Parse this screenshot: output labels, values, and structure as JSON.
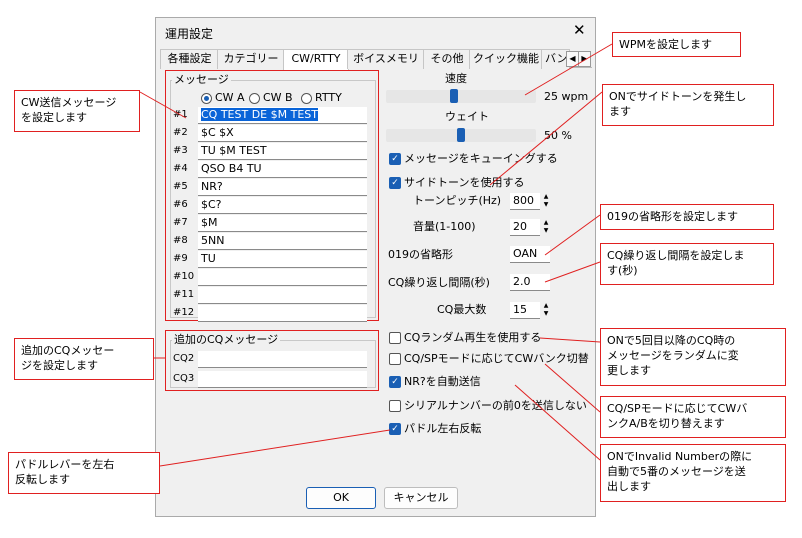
{
  "dialog": {
    "title": "運用設定",
    "close_glyph": "✕"
  },
  "tabs": [
    "各種設定",
    "カテゴリー",
    "CW/RTTY",
    "ボイスメモリ",
    "その他",
    "クイック機能",
    "バン"
  ],
  "tab_nav": {
    "prev": "◀",
    "next": "▶"
  },
  "messages": {
    "legend": "メッセージ",
    "modes": [
      "CW A",
      "CW B",
      "RTTY"
    ],
    "selected_mode": "CW A",
    "rows": [
      {
        "num": "#1",
        "text": "CQ TEST DE $M TEST"
      },
      {
        "num": "#2",
        "text": "$C $X"
      },
      {
        "num": "#3",
        "text": "TU $M TEST"
      },
      {
        "num": "#4",
        "text": "QSO B4 TU"
      },
      {
        "num": "#5",
        "text": "NR?"
      },
      {
        "num": "#6",
        "text": "$C?"
      },
      {
        "num": "#7",
        "text": "$M"
      },
      {
        "num": "#8",
        "text": "5NN"
      },
      {
        "num": "#9",
        "text": "TU"
      },
      {
        "num": "#10",
        "text": ""
      },
      {
        "num": "#11",
        "text": ""
      },
      {
        "num": "#12",
        "text": ""
      }
    ]
  },
  "extra_cq": {
    "legend": "追加のCQメッセージ",
    "rows": [
      {
        "num": "CQ2",
        "text": ""
      },
      {
        "num": "CQ3",
        "text": ""
      }
    ]
  },
  "settings": {
    "speed_label": "速度",
    "speed_value": "25 wpm",
    "speed_level": 0.45,
    "weight_label": "ウェイト",
    "weight_value": "50 %",
    "weight_level": 0.5,
    "queue_label": "メッセージをキューイングする",
    "sidetone_label": "サイドトーンを使用する",
    "tone_pitch_label": "トーンピッチ(Hz)",
    "tone_pitch_value": "800",
    "volume_label": "音量(1-100)",
    "volume_value": "20",
    "abbrev_label": "019の省略形",
    "abbrev_value": "OAN",
    "cq_interval_label": "CQ繰り返し間隔(秒)",
    "cq_interval_value": "2.0",
    "cq_max_label": "CQ最大数",
    "cq_max_value": "15",
    "cq_random_label": "CQランダム再生を使用する",
    "cq_sp_label": "CQ/SPモードに応じてCWバンク切替",
    "nr_auto_label": "NR?を自動送信",
    "serial_zero_label": "シリアルナンバーの前0を送信しない",
    "paddle_label": "パドル左右反転",
    "spin_up": "▲",
    "spin_down": "▼"
  },
  "buttons": {
    "ok": "OK",
    "cancel": "キャンセル"
  },
  "callouts": {
    "cw_msg": "CW送信メッセージ\nを設定します",
    "wpm": "WPMを設定します",
    "sidetone": "ONでサイドトーンを発生し\nます",
    "abbrev": "019の省略形を設定します",
    "cq_interval": "CQ繰り返し間隔を設定しま\nす(秒)",
    "extra_cq": "追加のCQメッセー\nジを設定します",
    "cq_random": "ONで5回目以降のCQ時の\nメッセージをランダムに変\n更します",
    "cq_sp": "CQ/SPモードに応じてCWバ\nンクA/Bを切り替えます",
    "nr_auto": "ONでInvalid Numberの際に\n自動で5番のメッセージを送\n出します",
    "paddle": "パドルレバーを左右\n反転します"
  },
  "accent_color": "#1a5fb4",
  "callout_color": "#e02020"
}
